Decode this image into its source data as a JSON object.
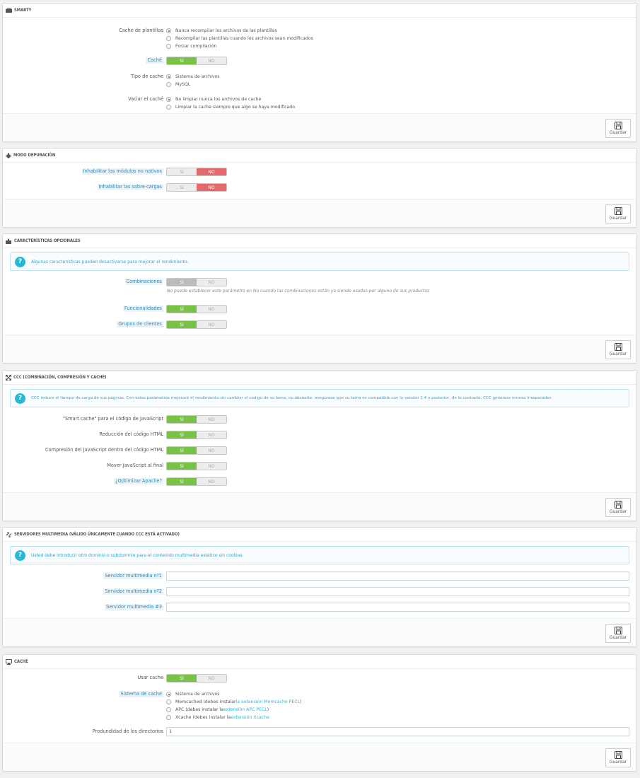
{
  "save_label": "Guardar",
  "smarty": {
    "title": "SMARTY",
    "cache_plantillas": {
      "label": "Cache de plantillas",
      "options": [
        "Nunca recompilar los archivos de las plantillas",
        "Recompilar las plantillas cuando los archivos sean modificados",
        "Forzar compilación"
      ]
    },
    "cache": {
      "label": "Caché",
      "yes": "SÍ",
      "no": "NO"
    },
    "tipo_cache": {
      "label": "Tipo de cache",
      "options": [
        "Sistema de archivos",
        "MySQL"
      ]
    },
    "vaciar": {
      "label": "Vaciar el caché",
      "options": [
        "No limpiar nunca los archivos de cache",
        "Limpiar la cache siempre que algo se haya modificado"
      ]
    }
  },
  "debug": {
    "title": "MODO DEPURACIÓN",
    "modules": {
      "label": "Inhabilitar los módulos no nativos",
      "yes": "SÍ",
      "no": "NO"
    },
    "overrides": {
      "label": "Inhabilitar las sobre-cargas",
      "yes": "SÍ",
      "no": "NO"
    }
  },
  "optional": {
    "title": "CARACTERÍSTICAS OPCIONALES",
    "alert": "Algunas características pueden desactivarse para mejorar el rendimiento.",
    "combinaciones": {
      "label": "Combinaciones",
      "yes": "SÍ",
      "no": "NO",
      "help": "No puede establecer este parámetro en No cuando las combinaciones están ya siendo usadas por alguno de sus productos"
    },
    "funcionalidades": {
      "label": "Funcionalidades",
      "yes": "SÍ",
      "no": "NO"
    },
    "grupos": {
      "label": "Grupos de clientes",
      "yes": "SÍ",
      "no": "NO"
    }
  },
  "ccc": {
    "title": "CCC (COMBINACIÓN, COMPRESIÓN Y CACHE)",
    "alert": "CCC reduce el tiempo de carga de sus páginas. Con estos parámetros mejorará el rendimiento sin cambiar el código de su tema, no obstante, asegúrese que su tema es compatible con la versión 1.4 o posterior, de lo contrario, CCC generara errores inesperados.",
    "rows": [
      {
        "label": "\"Smart cache\" para el código de JavaScript",
        "yes": "SÍ",
        "no": "NO"
      },
      {
        "label": "Reducción del código HTML",
        "yes": "SÍ",
        "no": "NO"
      },
      {
        "label": "Compresión del JavaScript dentro del código HTML",
        "yes": "SÍ",
        "no": "NO"
      },
      {
        "label": "Mover JavaScript al final",
        "yes": "SÍ",
        "no": "NO"
      },
      {
        "label": "¿Optimizar Apache?",
        "yes": "SÍ",
        "no": "NO"
      }
    ]
  },
  "media": {
    "title": "SERVIDORES MULTIMEDIA (VÁLIDO ÚNICAMENTE CUANDO CCC ESTÁ ACTIVADO)",
    "alert": "Usted debe introducir otro dominio o subdominio para el contenido multimedia estático sin cookies.",
    "servers": [
      {
        "label": "Servidor multimedia nº1",
        "value": ""
      },
      {
        "label": "Servidor multimedia nº2",
        "value": ""
      },
      {
        "label": "Servidor multimedia #3",
        "value": ""
      }
    ]
  },
  "cachepanel": {
    "title": "CACHE",
    "usar": {
      "label": "Usar cache",
      "yes": "SÍ",
      "no": "NO"
    },
    "sistema": {
      "label": "Sistema de cache",
      "o1": "Sistema de archivos",
      "o2a": "Memcached (debes instalar ",
      "o2b": "la extensión Memcache PECL",
      "o2c": ")",
      "o3a": "APC (debes instalar la ",
      "o3b": "extensión APC PECL",
      "o3c": ")",
      "o4a": "Xcache (debes instalar la ",
      "o4b": "extensión Xcache"
    },
    "profundidad": {
      "label": "Produndidad de los directorios",
      "value": "1"
    }
  }
}
